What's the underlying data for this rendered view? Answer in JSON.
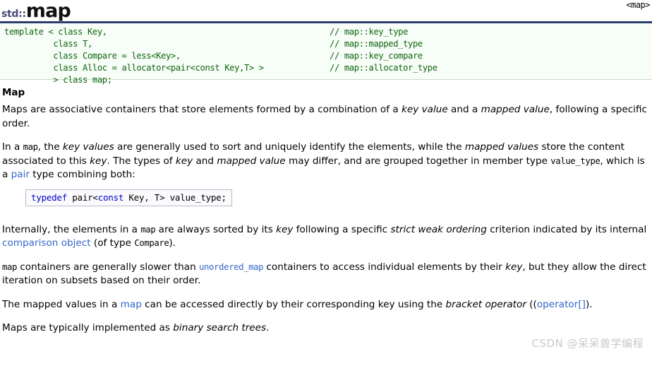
{
  "header": {
    "namespace": "std::",
    "name": "map",
    "include": "<map>"
  },
  "prototype": {
    "lines": [
      {
        "code": "template < class Key,",
        "comment": "// map::key_type"
      },
      {
        "code": "          class T,",
        "comment": "// map::mapped_type"
      },
      {
        "code": "          class Compare = less<Key>,",
        "comment": "// map::key_compare"
      },
      {
        "code": "          class Alloc = allocator<pair<const Key,T> >",
        "comment": "// map::allocator_type"
      },
      {
        "code": "          > class map;",
        "comment": ""
      }
    ]
  },
  "section": {
    "title": "Map"
  },
  "paragraphs": {
    "p1": {
      "t1": "Maps are associative containers that store elements formed by a combination of a ",
      "em1": "key value",
      "t2": " and a ",
      "em2": "mapped value",
      "t3": ", following a specific order."
    },
    "p2": {
      "t1": "In a ",
      "mono1": "map",
      "t2": ", the ",
      "em1": "key values",
      "t3": " are generally used to sort and uniquely identify the elements, while the ",
      "em2": "mapped values",
      "t4": " store the content associated to this ",
      "em3": "key",
      "t5": ". The types of ",
      "em4": "key",
      "t6": " and ",
      "em5": "mapped value",
      "t7": " may differ, and are grouped together in member type ",
      "mono2": "value_type",
      "t8": ", which is a ",
      "link1": "pair",
      "t9": " type combining both:"
    },
    "p3": {
      "t1": "Internally, the elements in a ",
      "mono1": "map",
      "t2": " are always sorted by its ",
      "em1": "key",
      "t3": " following a specific ",
      "em2": "strict weak ordering",
      "t4": " criterion indicated by its internal ",
      "link1": "comparison object",
      "t5": " (of type ",
      "mono2": "Compare",
      "t6": ")."
    },
    "p4": {
      "mono1": "map",
      "t1": " containers are generally slower than ",
      "link1": "unordered_map",
      "t2": " containers to access individual elements by their ",
      "em1": "key",
      "t3": ", but they allow the direct iteration on subsets based on their order."
    },
    "p5": {
      "t1": "The mapped values in a ",
      "link1": "map",
      "t2": " can be accessed directly by their corresponding key using the ",
      "em1": "bracket operator",
      "t3": " ((",
      "link2": "operator[]",
      "t4": ")."
    },
    "p6": {
      "t1": "Maps are typically implemented as ",
      "em1": "binary search trees",
      "t2": "."
    }
  },
  "typedef_box": {
    "kw1": "typedef",
    "mid": " pair<",
    "kw2": "const",
    "tail": " Key, T> value_type;"
  },
  "watermark": {
    "text": "CSDN @呆呆兽学编程"
  },
  "colors": {
    "link": "#3366cc",
    "code_green": "#116611",
    "keyword_blue": "#0000cc",
    "title_namespace": "#48497a",
    "rule": "#2c3e6b",
    "code_bg": "#f7fdf7",
    "watermark": "#c9c9c9"
  }
}
